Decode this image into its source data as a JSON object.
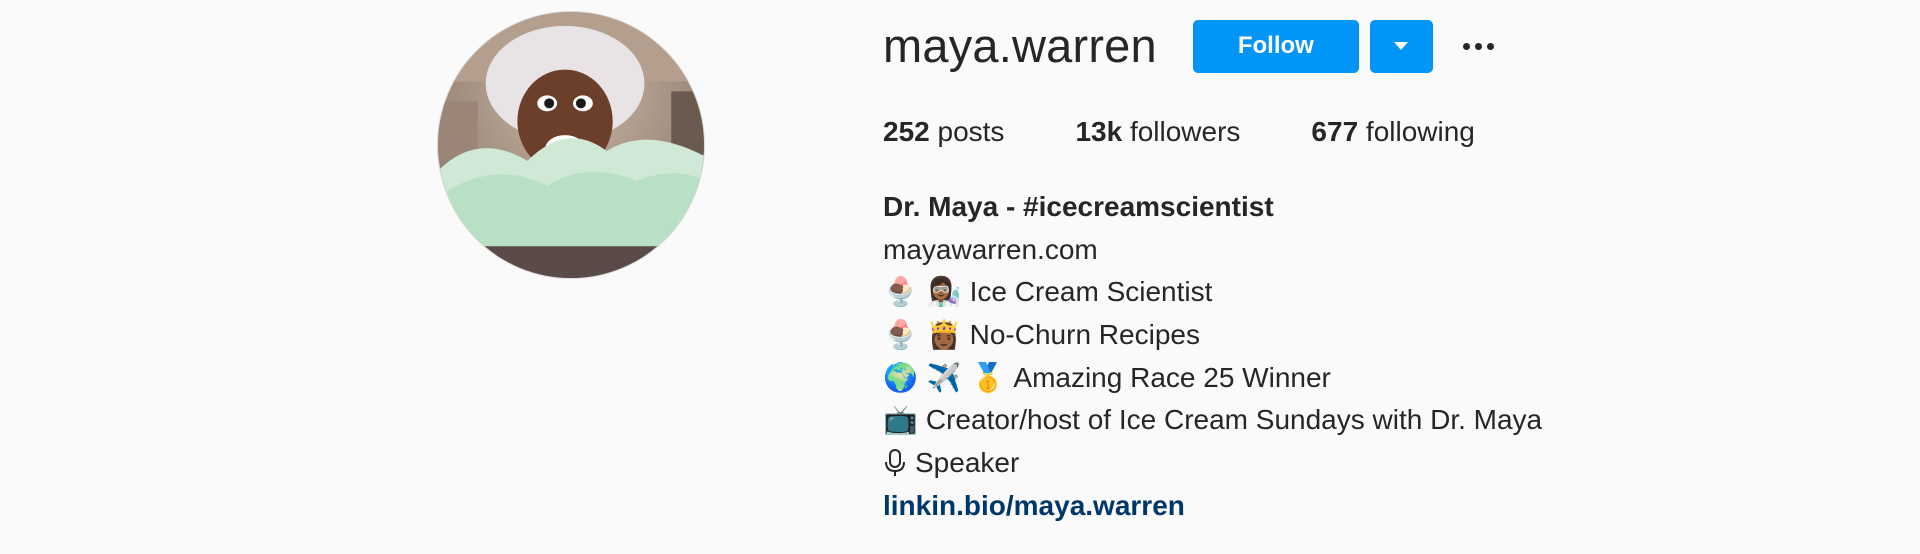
{
  "profile": {
    "username": "maya.warren",
    "follow_label": "Follow"
  },
  "stats": {
    "posts_count": "252",
    "posts_label": "posts",
    "followers_count": "13k",
    "followers_label": "followers",
    "following_count": "677",
    "following_label": "following"
  },
  "bio": {
    "full_name": "Dr. Maya - #icecreamscientist",
    "website": "mayawarren.com",
    "lines": [
      {
        "emoji": "🍨 👩🏾‍🔬",
        "text": "Ice Cream Scientist"
      },
      {
        "emoji": "🍨 👸🏾",
        "text": " No-Churn Recipes"
      },
      {
        "emoji": "🌍 ✈️ 🥇",
        "text": "Amazing Race 25 Winner"
      },
      {
        "emoji": "📺",
        "text": " Creator/host of Ice Cream Sundays with Dr. Maya"
      },
      {
        "emoji": "🎙",
        "text": "Speaker"
      }
    ],
    "link": "linkin.bio/maya.warren"
  },
  "icons": {
    "dropdown": "chevron-down-icon",
    "more": "more-options-icon",
    "mic": "microphone-icon"
  },
  "colors": {
    "accent": "#0095f6",
    "link": "#00376b",
    "text": "#262626",
    "background": "#fafafa"
  }
}
